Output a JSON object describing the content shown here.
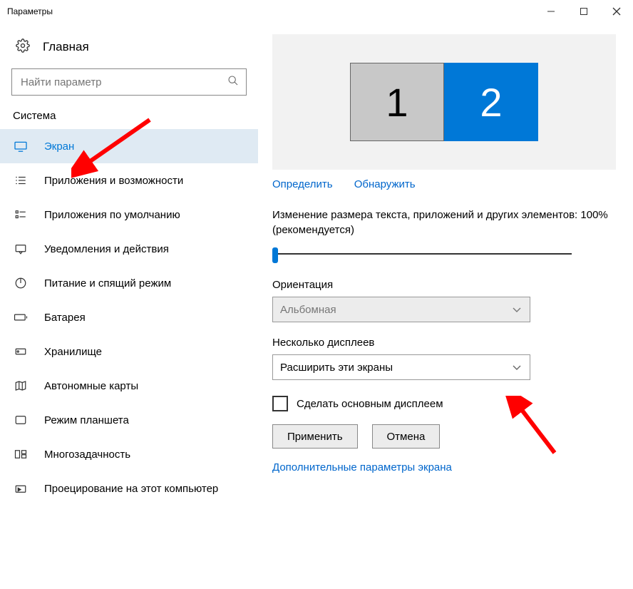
{
  "window": {
    "title": "Параметры"
  },
  "sidebar": {
    "home": "Главная",
    "search_placeholder": "Найти параметр",
    "section": "Система",
    "items": [
      {
        "label": "Экран"
      },
      {
        "label": "Приложения и возможности"
      },
      {
        "label": "Приложения по умолчанию"
      },
      {
        "label": "Уведомления и действия"
      },
      {
        "label": "Питание и спящий режим"
      },
      {
        "label": "Батарея"
      },
      {
        "label": "Хранилище"
      },
      {
        "label": "Автономные карты"
      },
      {
        "label": "Режим планшета"
      },
      {
        "label": "Многозадачность"
      },
      {
        "label": "Проецирование на этот компьютер"
      }
    ]
  },
  "main": {
    "monitors": [
      "1",
      "2"
    ],
    "identify": "Определить",
    "detect": "Обнаружить",
    "scale_text": "Изменение размера текста, приложений и других элементов: 100% (рекомендуется)",
    "orientation_label": "Ориентация",
    "orientation_value": "Альбомная",
    "multi_label": "Несколько дисплеев",
    "multi_value": "Расширить эти экраны",
    "main_checkbox_label": "Сделать основным дисплеем",
    "apply": "Применить",
    "cancel": "Отмена",
    "advanced": "Дополнительные параметры экрана"
  }
}
